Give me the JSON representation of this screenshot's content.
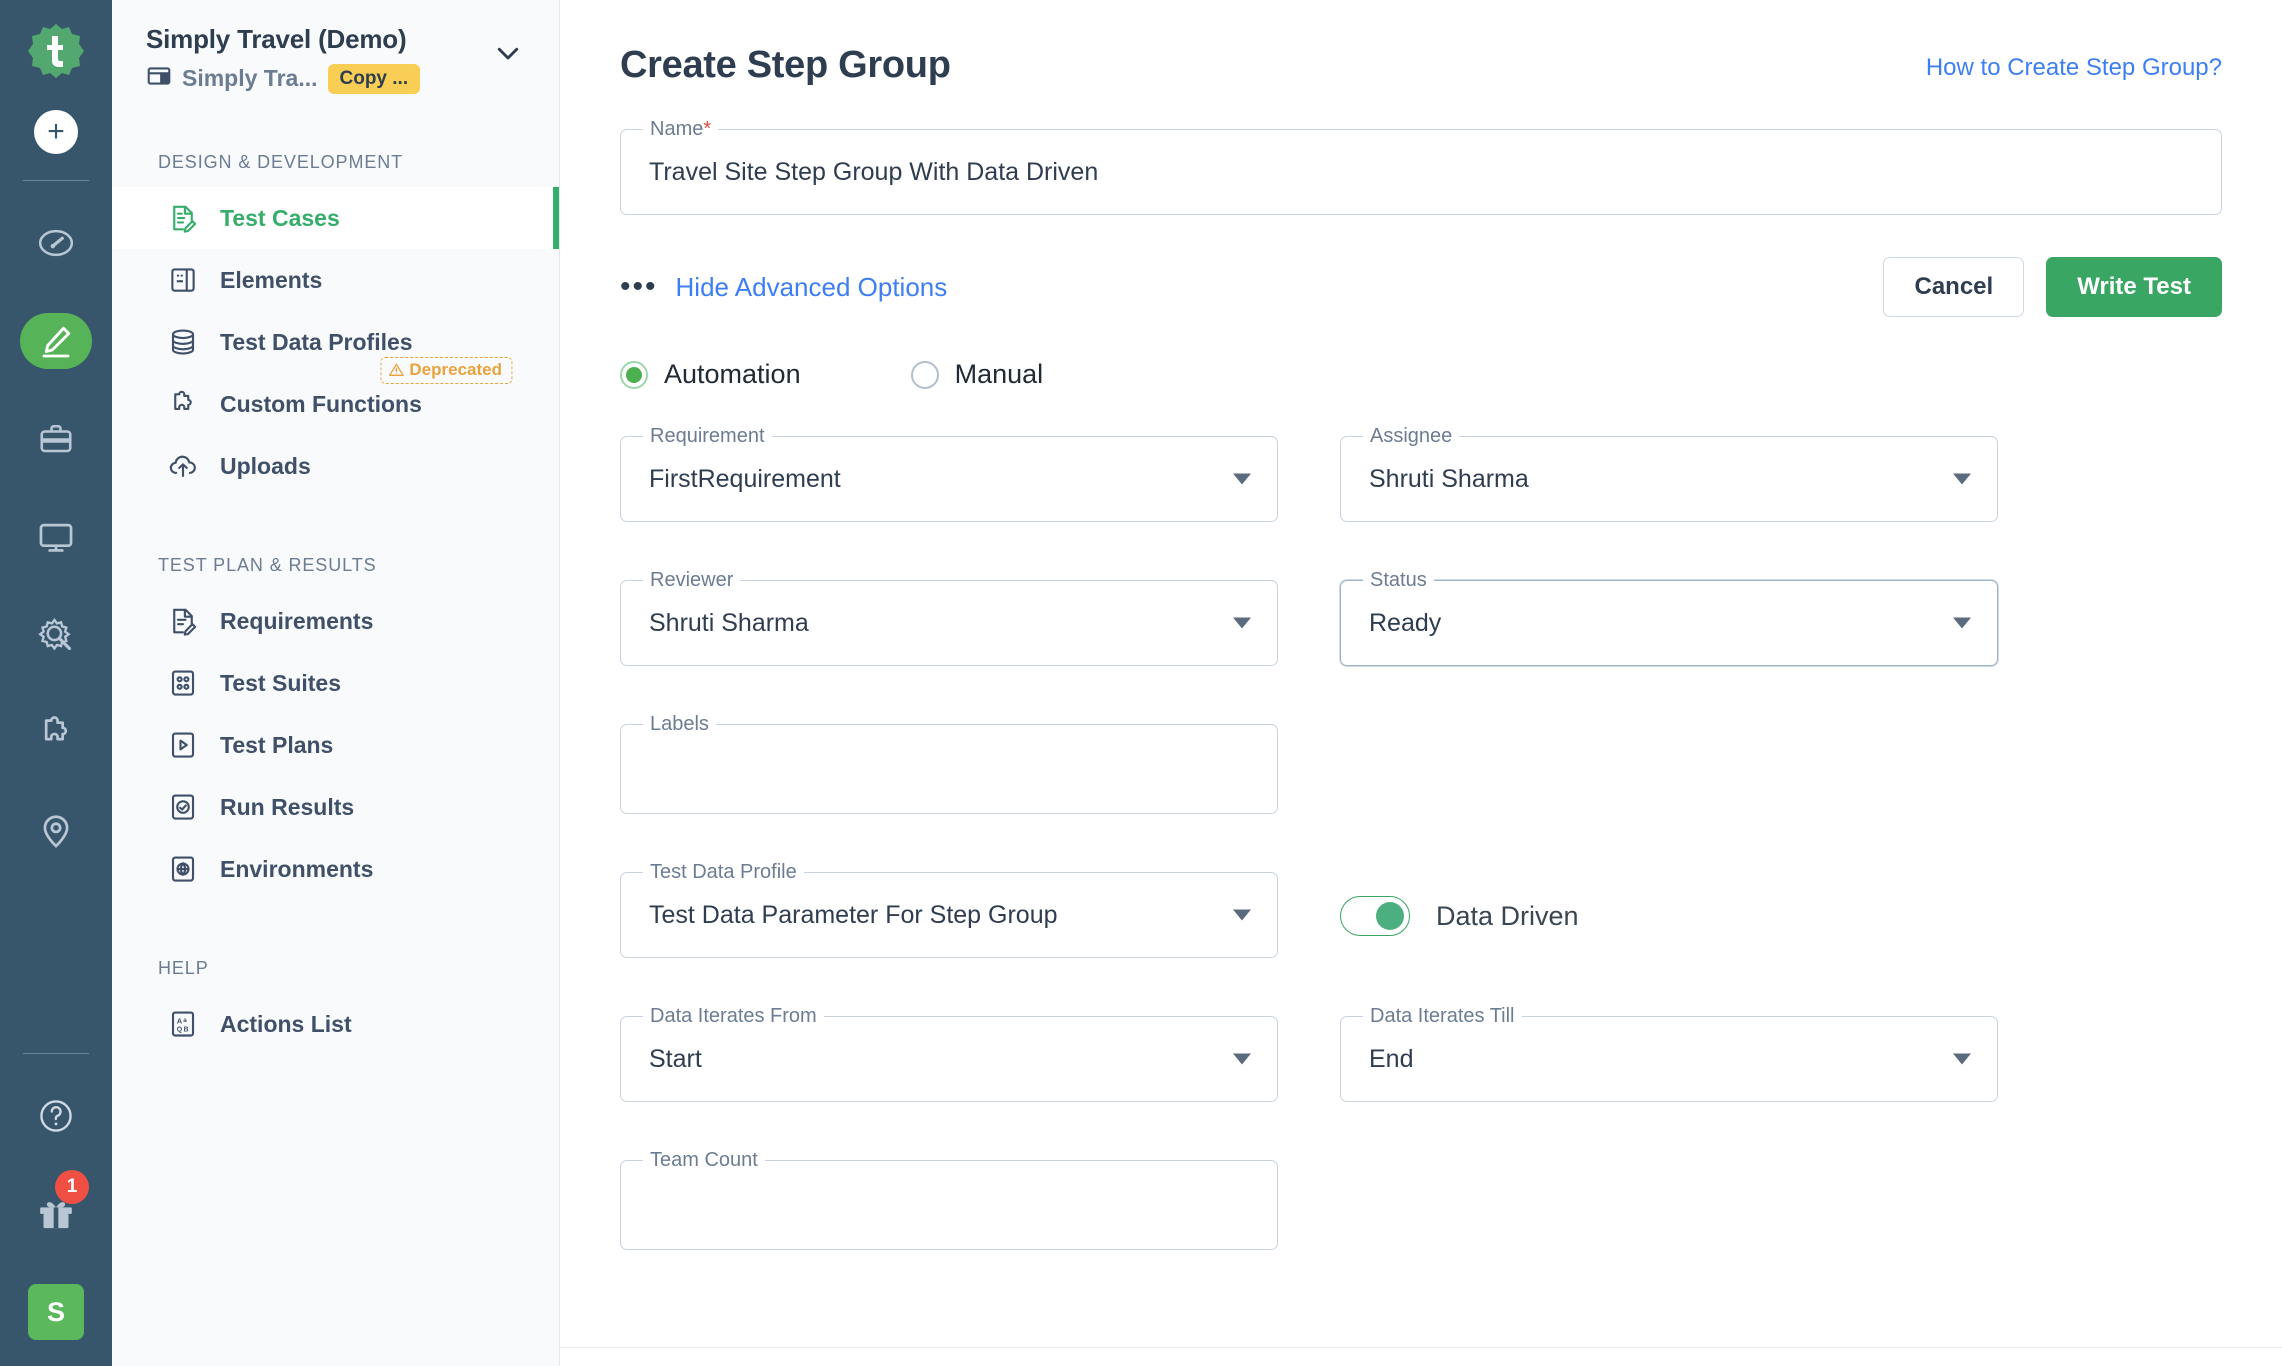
{
  "rail": {
    "logo_icon": "testsigma-logo-icon",
    "add_label": "+",
    "icons": [
      {
        "name": "dashboard-speedometer-icon",
        "active": false
      },
      {
        "name": "edit-pencil-icon",
        "active": true
      },
      {
        "name": "briefcase-icon",
        "active": false
      },
      {
        "name": "monitor-screen-icon",
        "active": false
      },
      {
        "name": "gear-wrench-icon",
        "active": false
      },
      {
        "name": "puzzle-piece-icon",
        "active": false
      },
      {
        "name": "location-pin-icon",
        "active": false
      }
    ],
    "help_icon": "question-circle-icon",
    "gift_icon": "gift-icon",
    "gift_badge": "1",
    "avatar_initial": "S"
  },
  "sidebar": {
    "project_title": "Simply Travel (Demo)",
    "project_sub": "Simply Tra...",
    "project_sub_icon": "application-window-icon",
    "copy_chip": "Copy ...",
    "caret_icon": "chevron-down-icon",
    "sections": [
      {
        "label": "DESIGN & DEVELOPMENT",
        "items": [
          {
            "label": "Test Cases",
            "icon": "test-case-edit-icon",
            "active": true,
            "badge": null
          },
          {
            "label": "Elements",
            "icon": "elements-panel-icon",
            "active": false,
            "badge": null
          },
          {
            "label": "Test Data Profiles",
            "icon": "database-icon",
            "active": false,
            "badge": null
          },
          {
            "label": "Custom Functions",
            "icon": "puzzle-piece-icon",
            "active": false,
            "badge": "Deprecated"
          },
          {
            "label": "Uploads",
            "icon": "cloud-upload-icon",
            "active": false,
            "badge": null
          }
        ]
      },
      {
        "label": "TEST PLAN & RESULTS",
        "items": [
          {
            "label": "Requirements",
            "icon": "requirements-doc-icon",
            "active": false,
            "badge": null
          },
          {
            "label": "Test Suites",
            "icon": "test-suites-grid-icon",
            "active": false,
            "badge": null
          },
          {
            "label": "Test Plans",
            "icon": "play-document-icon",
            "active": false,
            "badge": null
          },
          {
            "label": "Run Results",
            "icon": "run-results-chart-icon",
            "active": false,
            "badge": null
          },
          {
            "label": "Environments",
            "icon": "globe-document-icon",
            "active": false,
            "badge": null
          }
        ]
      },
      {
        "label": "HELP",
        "items": [
          {
            "label": "Actions List",
            "icon": "actions-list-icon",
            "active": false,
            "badge": null
          }
        ]
      }
    ]
  },
  "main": {
    "page_title": "Create Step Group",
    "help_link": "How to Create Step Group?",
    "name_field": {
      "label": "Name",
      "required_marker": "*",
      "value": "Travel Site Step Group With Data Driven"
    },
    "advanced": {
      "dots_icon": "more-options-icon",
      "toggle_label": "Hide Advanced Options",
      "cancel_label": "Cancel",
      "write_test_label": "Write Test"
    },
    "mode": {
      "options": [
        {
          "label": "Automation",
          "selected": true
        },
        {
          "label": "Manual",
          "selected": false
        }
      ]
    },
    "fields": {
      "requirement": {
        "label": "Requirement",
        "value": "FirstRequirement",
        "caret": "dropdown-caret-icon"
      },
      "assignee": {
        "label": "Assignee",
        "value": "Shruti Sharma",
        "caret": "dropdown-caret-icon"
      },
      "reviewer": {
        "label": "Reviewer",
        "value": "Shruti Sharma",
        "caret": "dropdown-caret-icon"
      },
      "status": {
        "label": "Status",
        "value": "Ready",
        "caret": "dropdown-caret-icon"
      },
      "labels": {
        "label": "Labels",
        "value": ""
      },
      "test_data_profile": {
        "label": "Test Data Profile",
        "value": "Test Data Parameter For Step Group",
        "caret": "dropdown-caret-icon"
      },
      "data_iterates_from": {
        "label": "Data Iterates From",
        "value": "Start",
        "caret": "dropdown-caret-icon"
      },
      "data_iterates_till": {
        "label": "Data Iterates Till",
        "value": "End",
        "caret": "dropdown-caret-icon"
      },
      "team_count": {
        "label": "Team Count",
        "value": ""
      }
    },
    "data_driven": {
      "label": "Data Driven",
      "on": true
    }
  },
  "colors": {
    "rail_bg": "#37566b",
    "accent_green": "#35ad6b",
    "link_blue": "#3d7ff2",
    "warn_orange": "#e8a33d",
    "chip_yellow": "#f8ce55",
    "badge_red": "#f05044"
  }
}
